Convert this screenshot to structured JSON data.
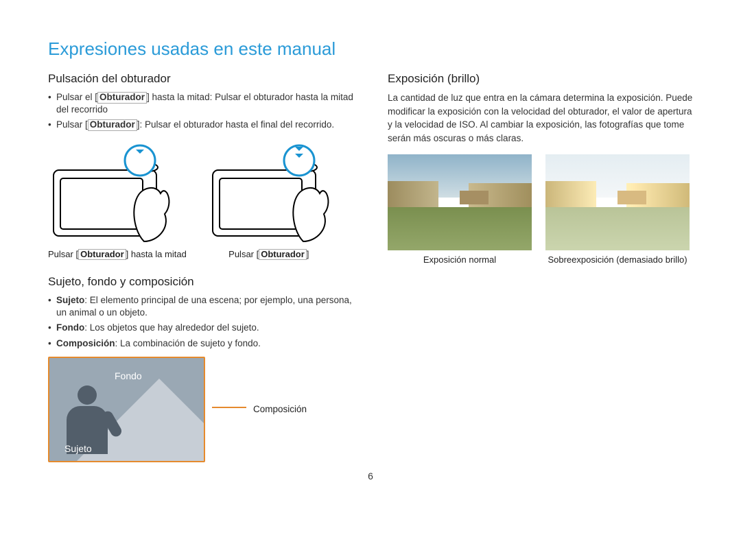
{
  "page_title": "Expresiones usadas en este manual",
  "page_number": "6",
  "left": {
    "section1": {
      "heading": "Pulsación del obturador",
      "bullet1_pre": "Pulsar el [",
      "bullet1_boxed": "Obturador",
      "bullet1_post": "] hasta la mitad: Pulsar el obturador hasta la mitad del recorrido",
      "bullet2_pre": "Pulsar [",
      "bullet2_boxed": "Obturador",
      "bullet2_post": "]: Pulsar el obturador hasta el final del recorrido.",
      "caption1_pre": "Pulsar [",
      "caption1_boxed": "Obturador",
      "caption1_post": "] hasta la mitad",
      "caption2_pre": "Pulsar [",
      "caption2_boxed": "Obturador",
      "caption2_post": "]"
    },
    "section2": {
      "heading": "Sujeto, fondo y composición",
      "b1_strong": "Sujeto",
      "b1_rest": ": El elemento principal de una escena; por ejemplo, una persona, un animal o un objeto.",
      "b2_strong": "Fondo",
      "b2_rest": ": Los objetos que hay alrededor del sujeto.",
      "b3_strong": "Composición",
      "b3_rest": ": La combinación de sujeto y fondo.",
      "img_label_fondo": "Fondo",
      "img_label_sujeto": "Sujeto",
      "arrow_label": "Composición"
    }
  },
  "right": {
    "heading": "Exposición (brillo)",
    "para": "La cantidad de luz que entra en la cámara determina la exposición. Puede modificar la exposición con la velocidad del obturador, el valor de apertura y la velocidad de ISO. Al cambiar la exposición, las fotografías que tome serán más oscuras o más claras.",
    "caption1": "Exposición normal",
    "caption2": "Sobreexposición (demasiado brillo)"
  }
}
